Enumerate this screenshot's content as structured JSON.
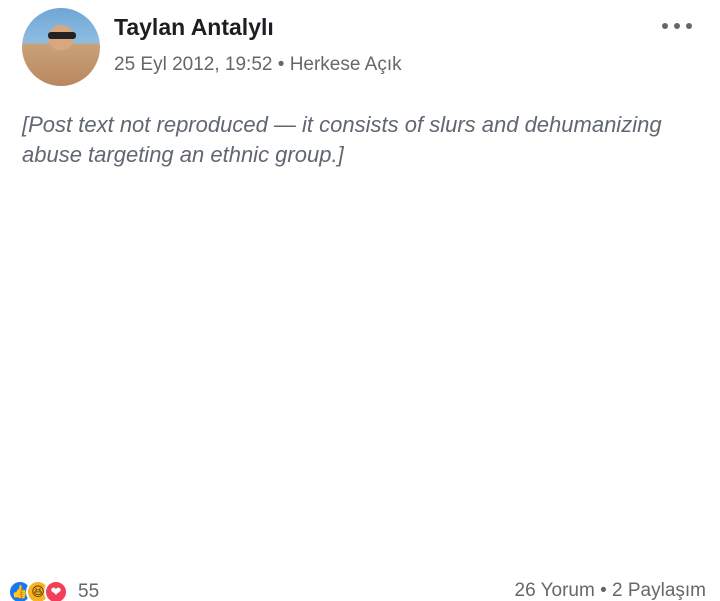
{
  "post": {
    "author": "Taylan Antalylı",
    "date": "25 Eyl 2012, 19:52",
    "separator": "•",
    "audience": "Herkese Açık",
    "body_notice": "[Post text not reproduced — it consists of slurs and dehumanizing abuse targeting an ethnic group.]"
  },
  "footer": {
    "reaction_icons": [
      "like-icon",
      "haha-icon",
      "love-icon"
    ],
    "reaction_count": "55",
    "comments": "26 Yorum",
    "separator": "•",
    "shares": "2 Paylaşım"
  },
  "colors": {
    "text": "#1c1e21",
    "secondary_text": "#65676b",
    "like": "#1877f2",
    "haha": "#f7b125",
    "love": "#f33e58"
  }
}
